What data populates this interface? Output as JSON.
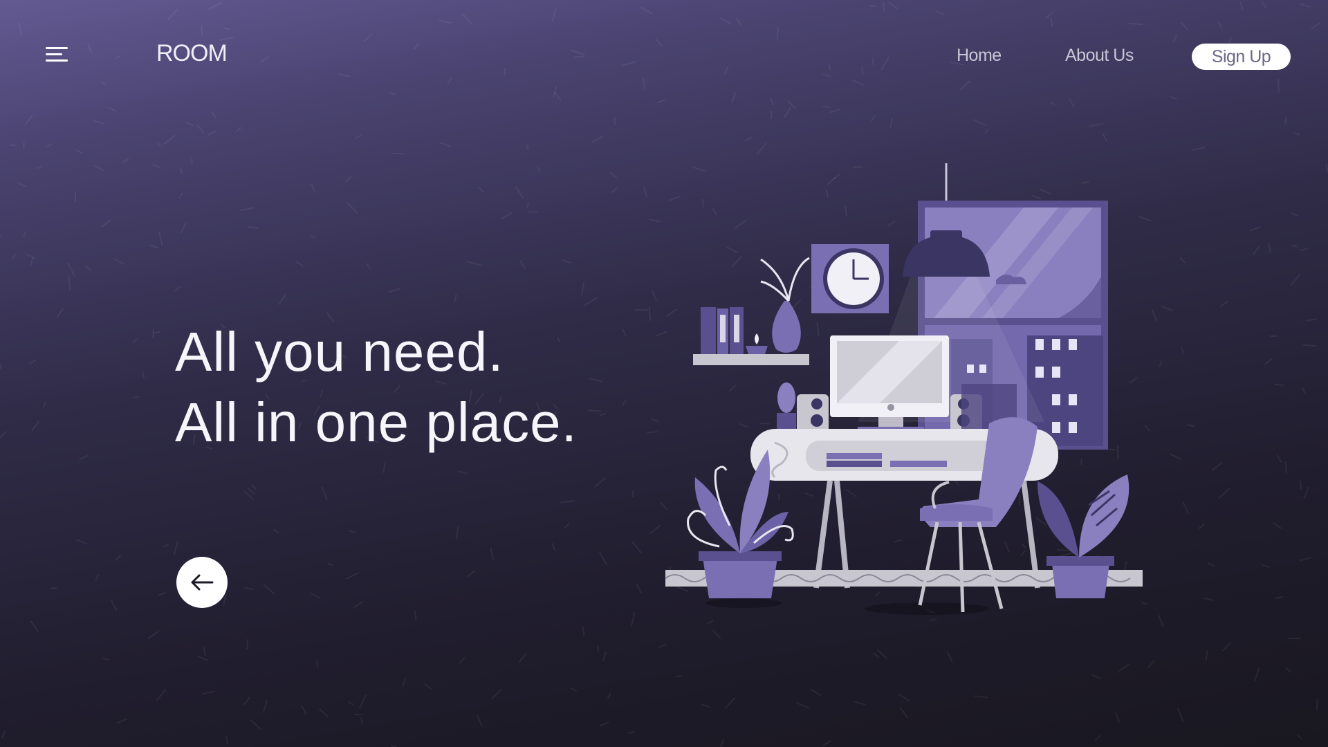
{
  "header": {
    "brand": "ROOM",
    "nav": {
      "home": "Home",
      "about": "About Us",
      "signup": "Sign Up"
    }
  },
  "hero": {
    "line1": "All you need.",
    "line2": "All in one place."
  },
  "icons": {
    "menu": "hamburger-menu-icon",
    "back": "arrow-left-icon"
  },
  "colors": {
    "background_top": "#635a92",
    "background_bottom": "#19171f",
    "accent_purple": "#7b70b3",
    "text": "#ffffff"
  }
}
